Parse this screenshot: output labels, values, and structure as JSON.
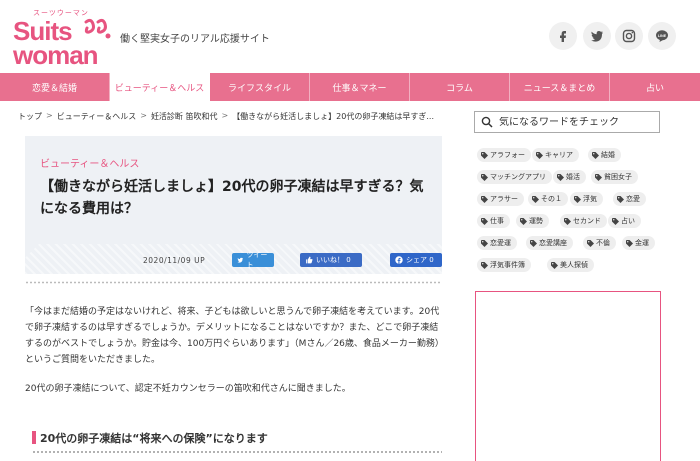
{
  "brand": {
    "logo_small": "スーツウーマン",
    "logo_top": "Suits",
    "logo_bottom": "woman",
    "tagline": "働く堅実女子のリアル応援サイト",
    "accent": "#e75480",
    "nav_color": "#e8708f"
  },
  "social": [
    "facebook-icon",
    "twitter-icon",
    "instagram-icon",
    "line-icon"
  ],
  "social_labels": {
    "line": "LINE"
  },
  "nav": [
    {
      "label": "恋愛＆結婚"
    },
    {
      "label": "ビューティー＆ヘルス"
    },
    {
      "label": "ライフスタイル"
    },
    {
      "label": "仕事＆マネー"
    },
    {
      "label": "コラム"
    },
    {
      "label": "ニュース＆まとめ"
    },
    {
      "label": "占い"
    }
  ],
  "breadcrumb": [
    {
      "label": "トップ"
    },
    {
      "label": "ビューティー＆ヘルス"
    },
    {
      "label": "妊活診断 笛吹和代"
    },
    {
      "label": "【働きながら妊活しましょ】20代の卵子凍結は早すぎ..."
    }
  ],
  "breadcrumb_sep": ">",
  "article": {
    "category": "ビューティー＆ヘルス",
    "title": "【働きながら妊活しましょ】20代の卵子凍結は早すぎる？気になる費用は？",
    "date": "2020/11/09 UP",
    "share_tweet": "ツイート",
    "share_like": "いいね！ 0",
    "share_fb": "シェア 0",
    "para1": "「今はまだ結婚の予定はないけれど、将来、子どもは欲しいと思うんで卵子凍結を考えています。20代で卵子凍結するのは早すぎるでしょうか。デメリットになることはないですか？また、どこで卵子凍結するのがベストでしょうか。貯金は今、100万円ぐらいあります」（Mさん／26歳、食品メーカー勤務）というご質問をいただきました。",
    "para2": "20代の卵子凍結について、認定不妊カウンセラーの笛吹和代さんに聞きました。",
    "heading": "20代の卵子凍結は“将来への保険”になります"
  },
  "sidebar": {
    "search_placeholder": "気になるワードをチェック",
    "tags": [
      "アラフォー",
      "キャリア",
      "結婚",
      "マッチングアプリ",
      "婚活",
      "貧困女子",
      "アラサー",
      "その１",
      "浮気",
      "恋愛",
      "仕事",
      "運勢",
      "セカンド",
      "占い",
      "恋愛運",
      "恋愛講座",
      "不倫",
      "金運",
      "浮気事件簿",
      "美人探偵"
    ]
  }
}
